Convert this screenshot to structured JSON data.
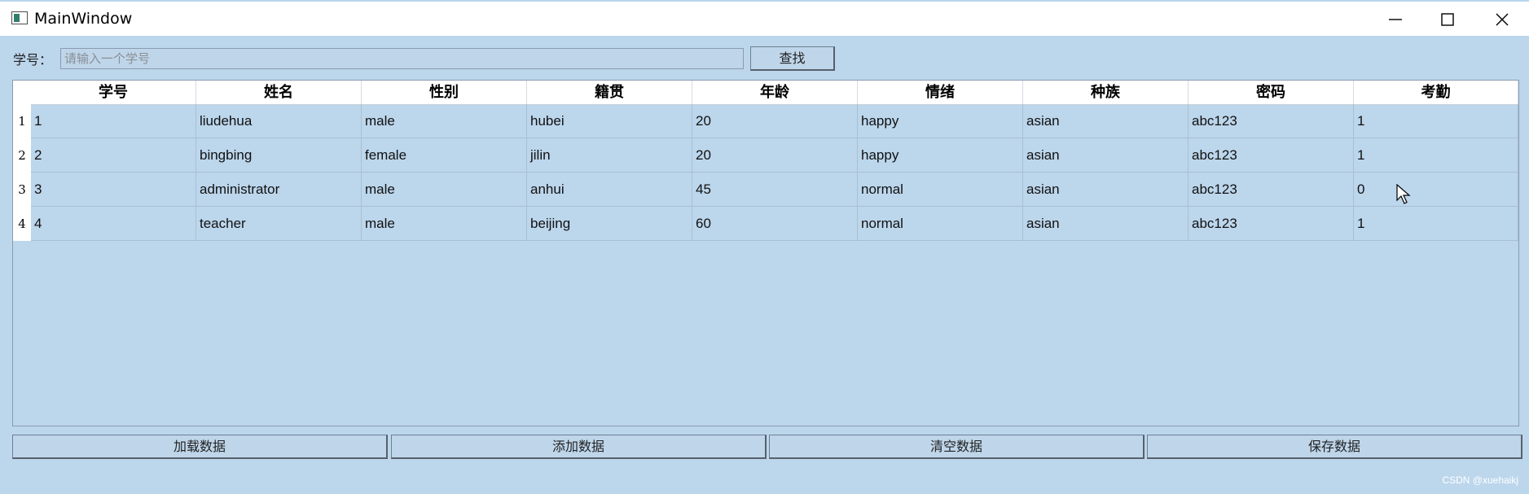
{
  "window": {
    "title": "MainWindow"
  },
  "search": {
    "label": "学号：",
    "placeholder": "请输入一个学号",
    "button": "查找"
  },
  "table": {
    "columns": [
      "学号",
      "姓名",
      "性别",
      "籍贯",
      "年龄",
      "情绪",
      "种族",
      "密码",
      "考勤"
    ],
    "rows": [
      {
        "num": "1",
        "cells": [
          "1",
          "liudehua",
          "male",
          "hubei",
          "20",
          "happy",
          "asian",
          "abc123",
          "1"
        ]
      },
      {
        "num": "2",
        "cells": [
          "2",
          "bingbing",
          "female",
          "jilin",
          "20",
          "happy",
          "asian",
          "abc123",
          "1"
        ]
      },
      {
        "num": "3",
        "cells": [
          "3",
          "administrator",
          "male",
          "anhui",
          "45",
          "normal",
          "asian",
          "abc123",
          "0"
        ]
      },
      {
        "num": "4",
        "cells": [
          "4",
          "teacher",
          "male",
          "beijing",
          "60",
          "normal",
          "asian",
          "abc123",
          "1"
        ]
      }
    ]
  },
  "actions": {
    "load": "加载数据",
    "add": "添加数据",
    "clear": "清空数据",
    "save": "保存数据"
  },
  "watermark": "CSDN @xuehaikj",
  "colors": {
    "background": "#bcd6ec",
    "header": "#ffffff"
  }
}
